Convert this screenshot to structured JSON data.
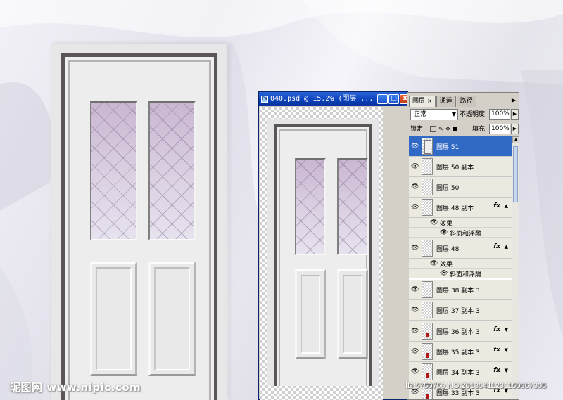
{
  "document_window": {
    "title": "040.psd @ 15.2% (图层 ...",
    "minimize_glyph": "_",
    "maximize_glyph": "□",
    "close_glyph": "x"
  },
  "layers_panel": {
    "tabs": [
      {
        "label": "图层",
        "active": true,
        "close": "×"
      },
      {
        "label": "通道",
        "active": false
      },
      {
        "label": "路径",
        "active": false
      }
    ],
    "blend_mode": "正常",
    "opacity_label": "不透明度:",
    "opacity_value": "100%",
    "lock_label": "锁定:",
    "fill_label": "填充:",
    "fill_value": "100%",
    "layers": [
      {
        "name": "图层 51",
        "selected": true,
        "thumb": "door"
      },
      {
        "name": "图层 50 副本",
        "thumb": "checker"
      },
      {
        "name": "图层 50",
        "thumb": "checker"
      },
      {
        "name": "图层 48 副本",
        "thumb": "checker",
        "fx": "fx",
        "effects_label": "效果",
        "effect": "斜面和浮雕"
      },
      {
        "name": "图层 48",
        "thumb": "checker",
        "fx": "fx",
        "effects_label": "效果",
        "effect": "斜面和浮雕"
      },
      {
        "name": "图层 38 副本 3",
        "thumb": "checker"
      },
      {
        "name": "图层 37 副本 3",
        "thumb": "checker"
      },
      {
        "name": "图层 36 副本 3",
        "thumb": "red",
        "fx": "fx"
      },
      {
        "name": "图层 35 副本 3",
        "thumb": "red",
        "fx": "fx"
      },
      {
        "name": "图层 34 副本 3",
        "thumb": "red",
        "fx": "fx"
      },
      {
        "name": "图层 33 副本 3",
        "thumb": "red",
        "fx": "fx"
      }
    ]
  },
  "watermark": {
    "left": "昵图网 www.nipic.com",
    "right": "ID:5750750 NO:20130411231150067305"
  }
}
